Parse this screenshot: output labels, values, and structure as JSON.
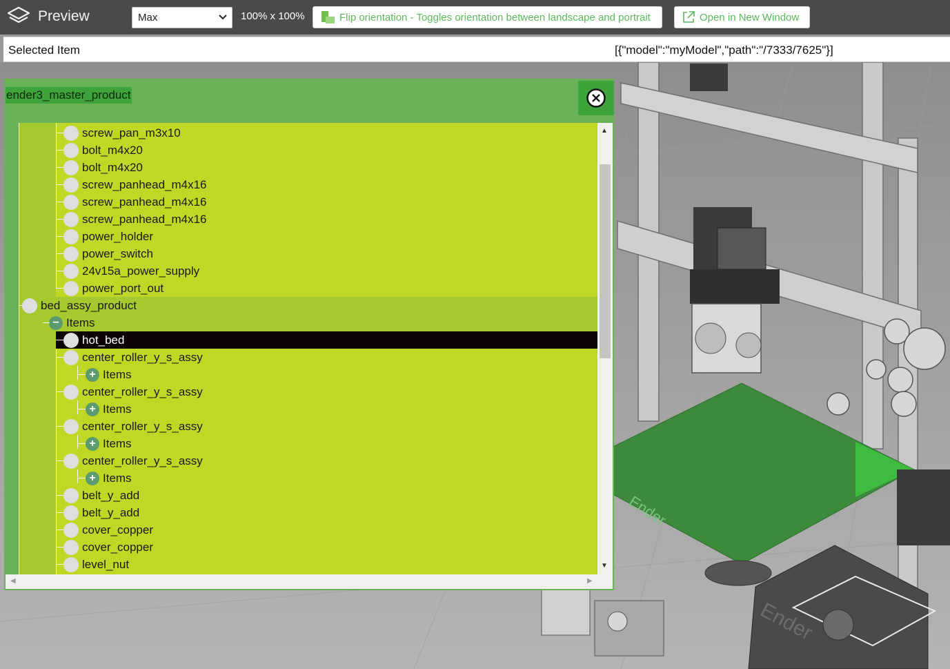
{
  "header": {
    "app_title": "Preview",
    "size_select": {
      "value": "Max"
    },
    "zoom_text": "100% x 100%",
    "flip_button": "Flip orientation - Toggles orientation between landscape and portrait",
    "open_button": "Open in New Window",
    "accent_color": "#5cb85c"
  },
  "selected_item": {
    "label": "Selected Item",
    "value": "[{\"model\":\"myModel\",\"path\":\"/7333/7625\"}]"
  },
  "tree_panel": {
    "title": "ender3_master_product",
    "close_icon": "close-circle-icon",
    "rows": [
      {
        "label": "screw_pan_m3x10",
        "type": "leaf"
      },
      {
        "label": "bolt_m4x20",
        "type": "leaf"
      },
      {
        "label": "bolt_m4x20",
        "type": "leaf"
      },
      {
        "label": "screw_panhead_m4x16",
        "type": "leaf"
      },
      {
        "label": "screw_panhead_m4x16",
        "type": "leaf"
      },
      {
        "label": "screw_panhead_m4x16",
        "type": "leaf"
      },
      {
        "label": "power_holder",
        "type": "leaf"
      },
      {
        "label": "power_switch",
        "type": "leaf"
      },
      {
        "label": "24v15a_power_supply",
        "type": "leaf"
      },
      {
        "label": "power_port_out",
        "type": "leaf"
      },
      {
        "label": "bed_assy_product",
        "type": "node"
      },
      {
        "label": "Items",
        "type": "collapse"
      },
      {
        "label": "hot_bed",
        "type": "leaf",
        "selected": true
      },
      {
        "label": "center_roller_y_s_assy",
        "type": "leaf"
      },
      {
        "label": "Items",
        "type": "expand"
      },
      {
        "label": "center_roller_y_s_assy",
        "type": "leaf"
      },
      {
        "label": "Items",
        "type": "expand"
      },
      {
        "label": "center_roller_y_s_assy",
        "type": "leaf"
      },
      {
        "label": "Items",
        "type": "expand"
      },
      {
        "label": "center_roller_y_s_assy",
        "type": "leaf"
      },
      {
        "label": "Items",
        "type": "expand"
      },
      {
        "label": "belt_y_add",
        "type": "leaf"
      },
      {
        "label": "belt_y_add",
        "type": "leaf"
      },
      {
        "label": "cover_copper",
        "type": "leaf"
      },
      {
        "label": "cover_copper",
        "type": "leaf"
      },
      {
        "label": "level_nut",
        "type": "leaf"
      }
    ]
  },
  "viewport": {
    "bed_label": "Ender",
    "controller_label": "Ender"
  }
}
